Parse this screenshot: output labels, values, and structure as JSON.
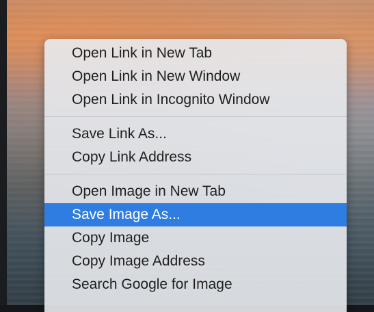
{
  "background": {
    "description_icon": "photo-background"
  },
  "menu": {
    "groups": [
      {
        "items": [
          {
            "label": "Open Link in New Tab"
          },
          {
            "label": "Open Link in New Window"
          },
          {
            "label": "Open Link in Incognito Window"
          }
        ]
      },
      {
        "items": [
          {
            "label": "Save Link As..."
          },
          {
            "label": "Copy Link Address"
          }
        ]
      },
      {
        "items": [
          {
            "label": "Open Image in New Tab"
          },
          {
            "label": "Save Image As...",
            "highlighted": true
          },
          {
            "label": "Copy Image"
          },
          {
            "label": "Copy Image Address"
          },
          {
            "label": "Search Google for Image"
          }
        ]
      }
    ],
    "highlight_color": "#2f7de1"
  }
}
